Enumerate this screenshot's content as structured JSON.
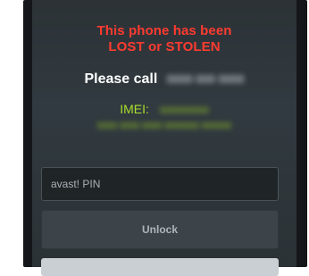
{
  "warning": {
    "line1": "This phone has been",
    "line2": "LOST or STOLEN"
  },
  "contact": {
    "label": "Please call",
    "number": "0000 000 0000"
  },
  "imei": {
    "label": "IMEI:",
    "value": "000000000",
    "value_line2": "0000 0000 0000 0000000 000000"
  },
  "pin": {
    "placeholder": "avast! PIN"
  },
  "actions": {
    "unlock_label": "Unlock"
  },
  "colors": {
    "warning": "#ff3b30",
    "imei": "#a8df2a",
    "background": "#2e353a"
  }
}
